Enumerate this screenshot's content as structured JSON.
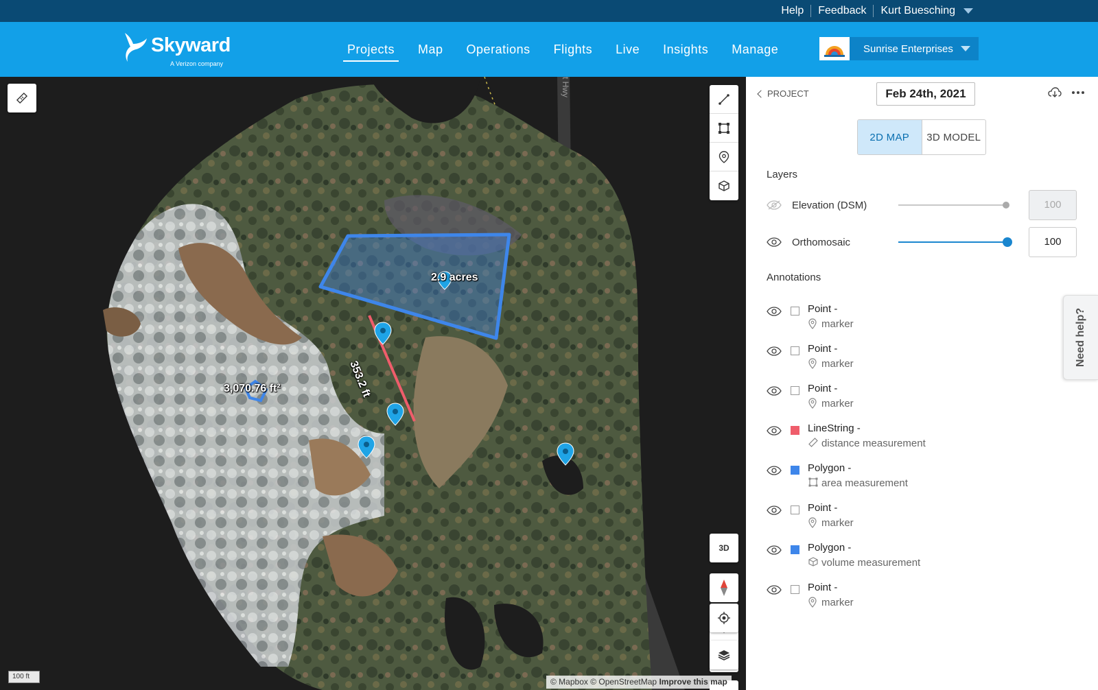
{
  "util": {
    "help": "Help",
    "feedback": "Feedback",
    "user": "Kurt Buesching"
  },
  "brand": {
    "name": "Skyward",
    "tagline": "A Verizon company"
  },
  "nav": [
    "Projects",
    "Map",
    "Operations",
    "Flights",
    "Live",
    "Insights",
    "Manage"
  ],
  "org": {
    "name": "Sunrise Enterprises"
  },
  "map": {
    "road": "st Hwy",
    "area_label": "2.9 acres",
    "distance_label": "353.2 ft",
    "volume_label": "3,070.76 ft²",
    "scale": "100 ft",
    "btn_3d": "3D",
    "attribution": {
      "a": "© Mapbox © OpenStreetMap",
      "b": "Improve this map"
    }
  },
  "panel": {
    "back": "PROJECT",
    "date": "Feb 24th, 2021",
    "tabs": {
      "map2d": "2D MAP",
      "model3d": "3D MODEL"
    },
    "layers_title": "Layers",
    "layers": [
      {
        "name": "Elevation (DSM)",
        "value": "100",
        "level": 1.0,
        "visible": false
      },
      {
        "name": "Orthomosaic",
        "value": "100",
        "level": 1.0,
        "visible": true
      }
    ],
    "annotations_title": "Annotations",
    "annotations": [
      {
        "type": "Point -",
        "desc": "marker",
        "color": "none",
        "icon": "marker-icon"
      },
      {
        "type": "Point -",
        "desc": "marker",
        "color": "none",
        "icon": "marker-icon"
      },
      {
        "type": "Point -",
        "desc": "marker",
        "color": "none",
        "icon": "marker-icon"
      },
      {
        "type": "LineString -",
        "desc": "distance measurement",
        "color": "#ef5d6b",
        "icon": "ruler-icon"
      },
      {
        "type": "Polygon -",
        "desc": "area measurement",
        "color": "#3e86ea",
        "icon": "area-icon"
      },
      {
        "type": "Point -",
        "desc": "marker",
        "color": "none",
        "icon": "marker-icon"
      },
      {
        "type": "Polygon -",
        "desc": "volume measurement",
        "color": "#3e86ea",
        "icon": "cube-icon"
      },
      {
        "type": "Point -",
        "desc": "marker",
        "color": "none",
        "icon": "marker-icon"
      }
    ],
    "need_help": "Need help?"
  },
  "colors": {
    "utilbar": "#0a4a74",
    "header": "#12a0e8",
    "accent": "#1a86cf",
    "polygon": "#3e86ea",
    "line": "#ef5d6b"
  }
}
